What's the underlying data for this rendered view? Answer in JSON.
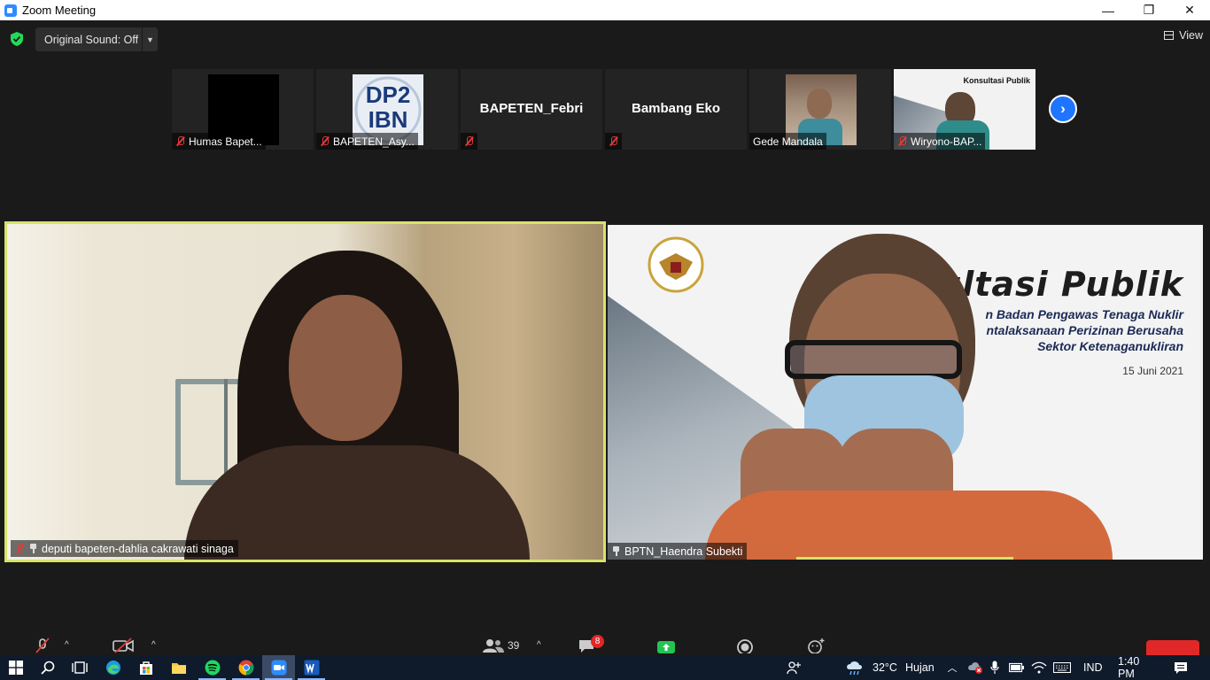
{
  "window": {
    "title": "Zoom Meeting",
    "minimize": "—",
    "restore": "❐",
    "close": "✕"
  },
  "topbar": {
    "sound_label": "Original Sound: Off",
    "view_label": "View"
  },
  "strip": [
    {
      "name": "Humas Bapet...",
      "muted": true
    },
    {
      "name": "BAPETEN_Asy...",
      "muted": true,
      "image_text": "DP2\nIBN"
    },
    {
      "name": "",
      "center": "BAPETEN_Febri",
      "muted": true
    },
    {
      "name": "",
      "center": "Bambang Eko",
      "muted": true
    },
    {
      "name": "Gede Mandala",
      "muted": false
    },
    {
      "name": "Wiryono-BAP...",
      "muted": true
    }
  ],
  "main_videos": [
    {
      "name": "deputi bapeten-dahlia cakrawati sinaga",
      "muted": true,
      "pinned": true
    },
    {
      "name": "BPTN_Haendra Subekti",
      "muted": false,
      "pinned": true
    }
  ],
  "slide": {
    "title": "Konsultasi Publik",
    "lines": [
      "n Badan Pengawas  Tenaga Nuklir",
      "ntalaksanaan Perizinan Berusaha",
      "Sektor Ketenaganukliran"
    ],
    "date": "15 Juni 2021"
  },
  "toolbar": {
    "participants_count": "39",
    "chat_badge": "8"
  },
  "taskbar": {
    "weather_temp": "32°C",
    "weather_text": "Hujan",
    "lang": "IND",
    "time": "1:40 PM"
  },
  "colors": {
    "zoom_blue": "#2d8cff",
    "active_speaker": "#d7e36a",
    "end_red": "#e02828",
    "taskbar": "#0f1a2b"
  }
}
